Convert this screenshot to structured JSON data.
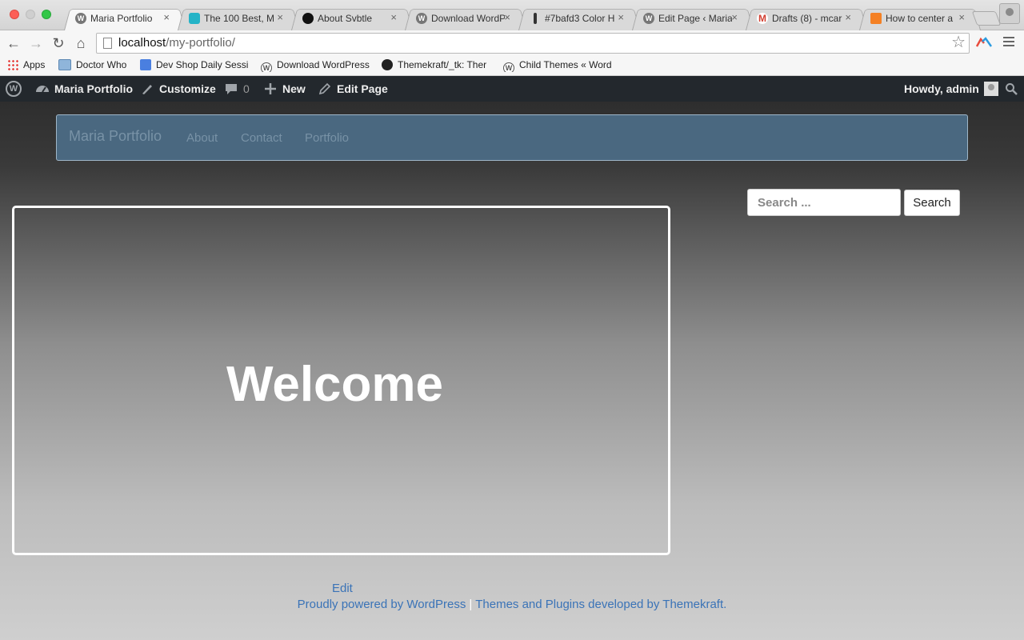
{
  "browser": {
    "tabs": [
      {
        "title": "Maria Portfolio",
        "active": true,
        "favicon": "wordpress-icon"
      },
      {
        "title": "The 100 Best, M",
        "active": false,
        "favicon": "site-icon"
      },
      {
        "title": "About Svbtle",
        "active": false,
        "favicon": "svbtle-icon"
      },
      {
        "title": "Download WordP",
        "active": false,
        "favicon": "wordpress-icon"
      },
      {
        "title": "#7bafd3 Color H",
        "active": false,
        "favicon": "color-icon"
      },
      {
        "title": "Edit Page ‹ Maria",
        "active": false,
        "favicon": "wordpress-icon"
      },
      {
        "title": "Drafts (8) - mcar",
        "active": false,
        "favicon": "gmail-icon"
      },
      {
        "title": "How to center a",
        "active": false,
        "favicon": "stackoverflow-icon"
      }
    ],
    "address": {
      "host": "localhost",
      "path": "/my-portfolio/"
    },
    "bookmarks": [
      {
        "label": "Apps",
        "icon": "apps-grid-icon"
      },
      {
        "label": "Doctor Who",
        "icon": "folder-icon"
      },
      {
        "label": "Dev Shop Daily Sessi",
        "icon": "doc-icon"
      },
      {
        "label": "Download WordPress",
        "icon": "wordpress-icon"
      },
      {
        "label": "Themekraft/_tk: Ther",
        "icon": "github-icon"
      },
      {
        "label": "Child Themes « Word",
        "icon": "wordpress-icon"
      }
    ]
  },
  "adminbar": {
    "site_name": "Maria Portfolio",
    "customize": "Customize",
    "comments_count": "0",
    "new": "New",
    "edit_page": "Edit Page",
    "howdy": "Howdy, admin"
  },
  "site": {
    "brand": "Maria Portfolio",
    "nav": [
      "About",
      "Contact",
      "Portfolio"
    ],
    "search": {
      "placeholder": "Search ...",
      "button": "Search"
    },
    "hero_title": "Welcome",
    "edit_link": "Edit",
    "footer": {
      "powered": "Proudly powered by WordPress",
      "separator": "|",
      "themes": "Themes and Plugins developed by Themekraft."
    }
  },
  "colors": {
    "navbar": "#4a6880",
    "adminbar": "#23282d",
    "link": "#3a73b7"
  }
}
